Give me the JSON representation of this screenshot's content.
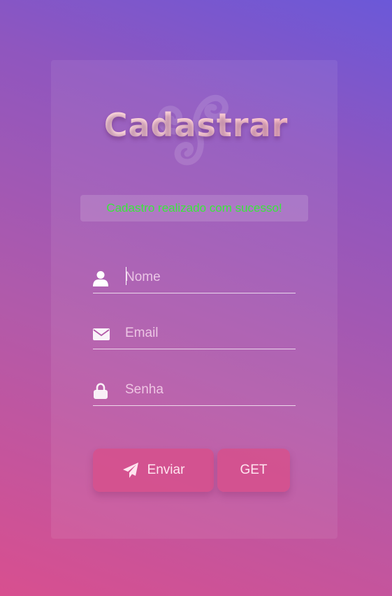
{
  "form": {
    "title": "Cadastrar",
    "status_message": "Cadastro realizado com sucesso!",
    "fields": {
      "name": {
        "placeholder": "Nome",
        "value": "",
        "icon": "user-icon"
      },
      "email": {
        "placeholder": "Email",
        "value": "",
        "icon": "envelope-icon"
      },
      "password": {
        "placeholder": "Senha",
        "value": "",
        "icon": "lock-icon"
      }
    },
    "buttons": {
      "submit_label": "Enviar",
      "submit_icon": "paper-plane-icon",
      "get_label": "GET"
    }
  },
  "colors": {
    "success_text": "#39e83b",
    "button_bg": "#d6508c",
    "title_gradient_end": "#ffb3bd"
  }
}
